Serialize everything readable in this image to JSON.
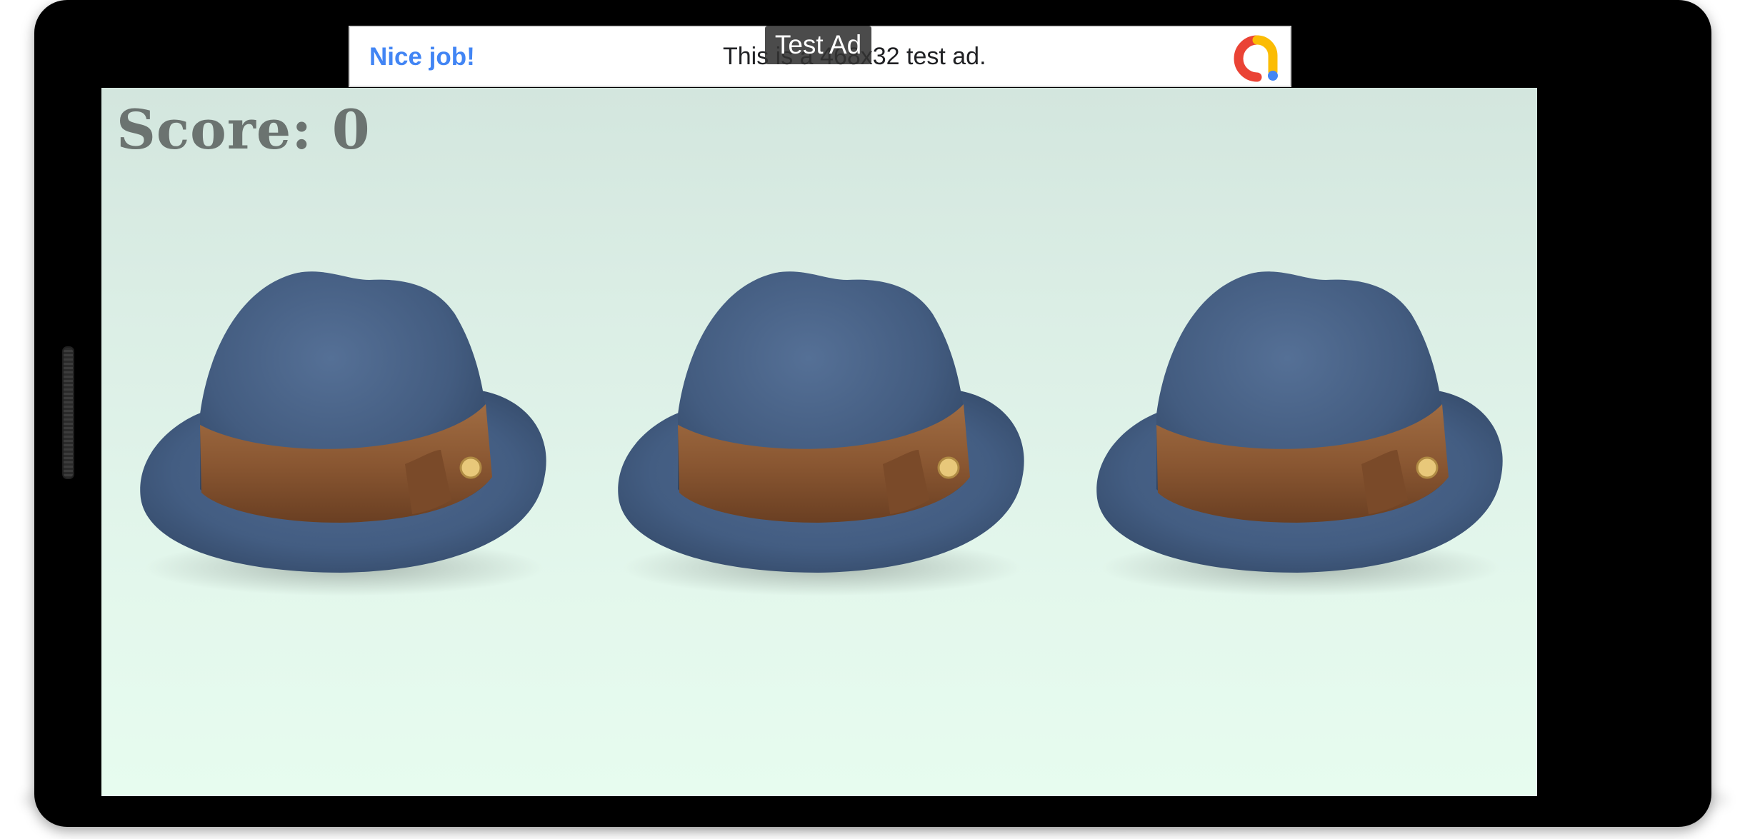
{
  "ad": {
    "headline": "Nice job!",
    "body": "This is a 468x32 test ad.",
    "label": "Test Ad",
    "logo_icon": "admob-logo-icon"
  },
  "game": {
    "score_label": "Score: 0",
    "hats": [
      {
        "name": "hat-1",
        "icon": "fedora-hat-icon"
      },
      {
        "name": "hat-2",
        "icon": "fedora-hat-icon"
      },
      {
        "name": "hat-3",
        "icon": "fedora-hat-icon"
      }
    ]
  },
  "colors": {
    "ad_headline": "#4285f4",
    "score_text": "#6b7370",
    "hat_felt": "#41597a",
    "hat_band": "#8a5732",
    "background_top": "#d3e6de",
    "background_bottom": "#e7fcef"
  }
}
